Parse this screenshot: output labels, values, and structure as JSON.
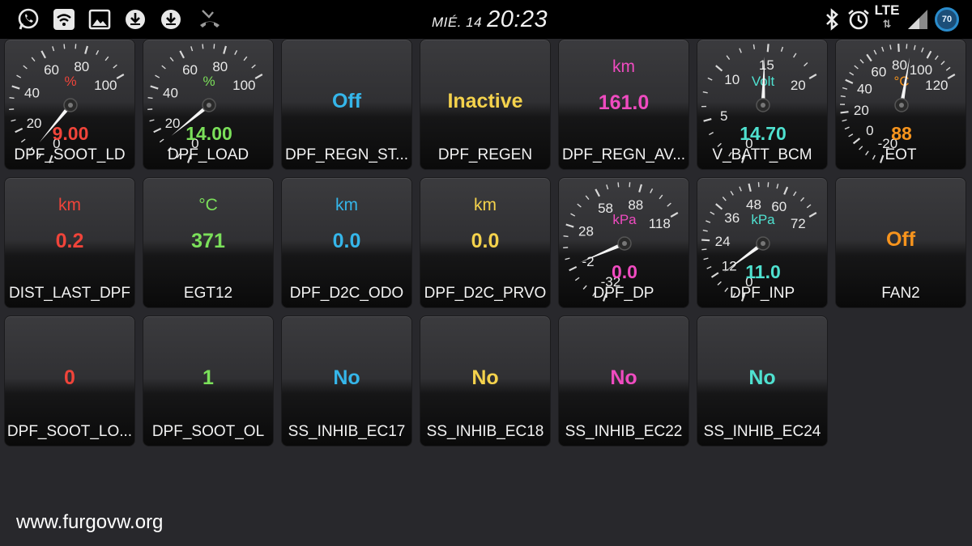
{
  "status_bar": {
    "day": "MIÉ. 14",
    "time": "20:23",
    "network": "LTE",
    "network_arrows": "⇅",
    "battery": "70",
    "icons_left": [
      "whatsapp-icon",
      "wifi-icon",
      "gallery-icon",
      "download-icon",
      "download-icon",
      "missed-call-icon"
    ],
    "icons_right": [
      "bluetooth-icon",
      "alarm-icon",
      "lte-icon",
      "signal-icon",
      "battery-icon"
    ]
  },
  "colors": {
    "red": "#f0443a",
    "green": "#7be05a",
    "blue": "#35b6ea",
    "yellow": "#f4d24c",
    "magenta": "#ef4bc0",
    "cyan": "#4fe1d0",
    "orange": "#f7941d"
  },
  "gauges": [
    {
      "id": "DPF_SOOT_LD",
      "label": "DPF_SOOT_LD",
      "unit": "%",
      "value_text": "9.00",
      "value": 9.0,
      "min": 0,
      "max": 100,
      "ticks": [
        "0",
        "20",
        "40",
        "60",
        "80",
        "100"
      ],
      "color": "#f0443a"
    },
    {
      "id": "DPF_LOAD",
      "label": "DPF_LOAD",
      "unit": "%",
      "value_text": "14.00",
      "value": 14.0,
      "min": 0,
      "max": 100,
      "ticks": [
        "0",
        "20",
        "40",
        "60",
        "80",
        "100"
      ],
      "color": "#7be05a"
    },
    {
      "id": "V_BATT_BCM",
      "label": "V_BATT_BCM",
      "unit": "Volt",
      "value_text": "14.70",
      "value": 14.7,
      "min": 0,
      "max": 20,
      "ticks": [
        "0",
        "5",
        "10",
        "15",
        "20"
      ],
      "color": "#4fe1d0"
    },
    {
      "id": "EOT",
      "label": "EOT",
      "unit": "°C",
      "value_text": "88",
      "value": 88,
      "min": -20,
      "max": 120,
      "ticks": [
        "-20",
        "0",
        "20",
        "40",
        "60",
        "80",
        "100",
        "120"
      ],
      "color": "#f7941d"
    },
    {
      "id": "DPF_DP",
      "label": "DPF_DP",
      "unit": "kPa",
      "value_text": "0.0",
      "value": 0.0,
      "min": -32,
      "max": 118,
      "ticks": [
        "-32",
        "-2",
        "28",
        "58",
        "88",
        "118"
      ],
      "color": "#ef4bc0"
    },
    {
      "id": "DPF_INP",
      "label": "DPF_INP",
      "unit": "kPa",
      "value_text": "11.0",
      "value": 11.0,
      "min": 0,
      "max": 72,
      "ticks": [
        "0",
        "12",
        "24",
        "36",
        "48",
        "60",
        "72"
      ],
      "color": "#4fe1d0"
    }
  ],
  "tiles": {
    "dpf_regn_st": {
      "label": "DPF_REGN_ST...",
      "value": "Off",
      "color": "#35b6ea"
    },
    "dpf_regen": {
      "label": "DPF_REGEN",
      "value": "Inactive",
      "color": "#f4d24c"
    },
    "dpf_regn_av": {
      "label": "DPF_REGN_AV...",
      "unit": "km",
      "value": "161.0",
      "color": "#ef4bc0"
    },
    "dist_last_dpf": {
      "label": "DIST_LAST_DPF",
      "unit": "km",
      "value": "0.2",
      "color": "#f0443a"
    },
    "egt12": {
      "label": "EGT12",
      "unit": "°C",
      "value": "371",
      "color": "#7be05a"
    },
    "dpf_d2c_odo": {
      "label": "DPF_D2C_ODO",
      "unit": "km",
      "value": "0.0",
      "color": "#35b6ea"
    },
    "dpf_d2c_prvo": {
      "label": "DPF_D2C_PRVO",
      "unit": "km",
      "value": "0.0",
      "color": "#f4d24c"
    },
    "fan2": {
      "label": "FAN2",
      "value": "Off",
      "color": "#f7941d"
    },
    "dpf_soot_lo": {
      "label": "DPF_SOOT_LO...",
      "value": "0",
      "color": "#f0443a"
    },
    "dpf_soot_ol": {
      "label": "DPF_SOOT_OL",
      "value": "1",
      "color": "#7be05a"
    },
    "ss_inhib_ec17": {
      "label": "SS_INHIB_EC17",
      "value": "No",
      "color": "#35b6ea"
    },
    "ss_inhib_ec18": {
      "label": "SS_INHIB_EC18",
      "value": "No",
      "color": "#f4d24c"
    },
    "ss_inhib_ec22": {
      "label": "SS_INHIB_EC22",
      "value": "No",
      "color": "#ef4bc0"
    },
    "ss_inhib_ec24": {
      "label": "SS_INHIB_EC24",
      "value": "No",
      "color": "#4fe1d0"
    }
  },
  "watermark": "www.furgovw.org"
}
